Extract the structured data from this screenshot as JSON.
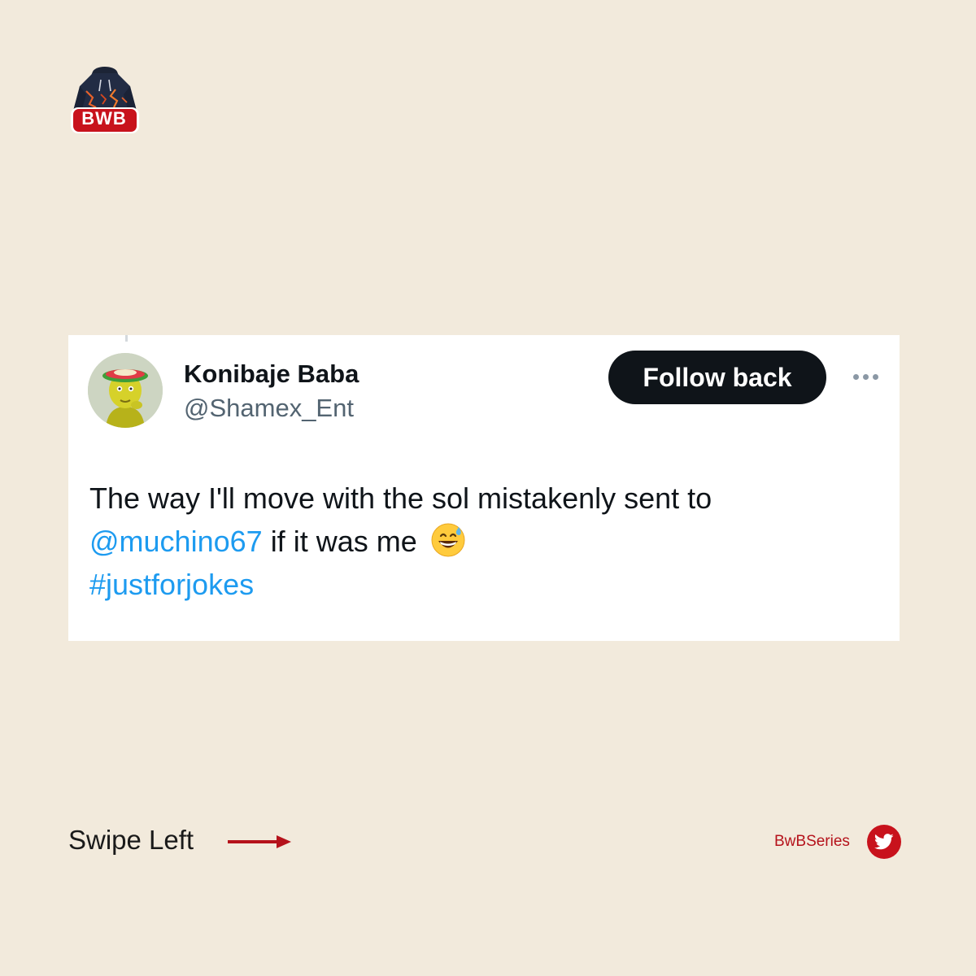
{
  "brand": {
    "logo_text": "BWB",
    "logo_icon": "hoodie-icon",
    "accent_color": "#c8121c"
  },
  "tweet": {
    "display_name": "Konibaje Baba",
    "handle": "@Shamex_Ent",
    "follow_button_label": "Follow back",
    "more_icon": "more-horizontal-icon",
    "text_before_mention": "The way I'll move with the sol mistakenly sent to",
    "mention": "@muchino67",
    "text_after_mention": "if it was me",
    "emoji": "😅",
    "hashtag": "#justforjokes"
  },
  "footer": {
    "swipe_label": "Swipe Left",
    "account_name": "BwBSeries",
    "twitter_icon": "twitter-bird-icon"
  },
  "colors": {
    "background": "#f2eadc",
    "link": "#1d9bf0",
    "button": "#0f1419"
  }
}
